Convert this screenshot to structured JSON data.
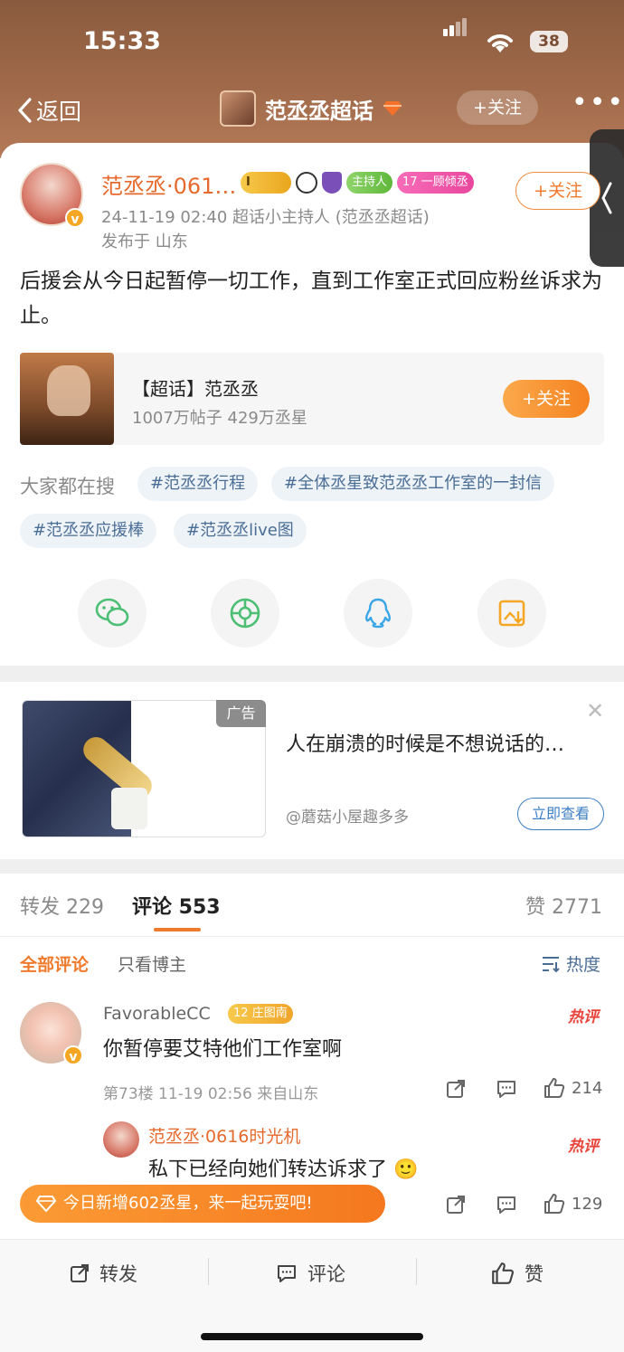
{
  "status_bar": {
    "time": "15:33",
    "battery": "38"
  },
  "nav": {
    "back_label": "返回",
    "title": "范丞丞超话",
    "follow_label": "+关注",
    "more_label": "•••"
  },
  "post": {
    "author": "范丞丞·061…",
    "level_badge": "I",
    "host_badge": "主持人",
    "fan_level": "17",
    "fan_badge": "一顾倾丞",
    "follow_label": "+关注",
    "time_role": "24-11-19 02:40  超话小主持人 (范丞丞超话)",
    "location": "发布于 山东",
    "content": "后援会从今日起暂停一切工作，直到工作室正式回应粉丝诉求为止。"
  },
  "topic_card": {
    "name": "【超话】范丞丞",
    "stats": "1007万帖子 429万丞星",
    "follow_label": "+关注"
  },
  "search": {
    "label": "大家都在搜",
    "tags": [
      "#范丞丞行程",
      "#全体丞星致范丞丞工作室的一封信",
      "#范丞丞应援棒",
      "#范丞丞live图"
    ]
  },
  "ad": {
    "tag": "广告",
    "title": "人在崩溃的时候是不想说话的…",
    "source": "@蘑菇小屋趣多多",
    "button": "立即查看"
  },
  "tabs": {
    "repost": "转发 229",
    "comments": "评论 553",
    "likes": "赞 2771"
  },
  "filter": {
    "all": "全部评论",
    "author_only": "只看博主",
    "sort": "热度"
  },
  "comments": [
    {
      "name": "FavorableCC",
      "badge_level": "12",
      "badge_text": "庄图南",
      "hot": "热评",
      "text": "你暂停要艾特他们工作室啊",
      "meta": "第73楼 11-19 02:56 来自山东",
      "likes": "214"
    },
    {
      "name": "范丞丞·0616时光机",
      "hot": "热评",
      "text": "私下已经向她们转达诉求了",
      "likes": "129"
    }
  ],
  "promo": "今日新增602丞星，来一起玩耍吧!",
  "bottom_bar": {
    "repost": "转发",
    "comment": "评论",
    "like": "赞"
  },
  "colors": {
    "accent": "#f07a2c",
    "link": "#4a6d95",
    "hot": "#e8443a"
  }
}
